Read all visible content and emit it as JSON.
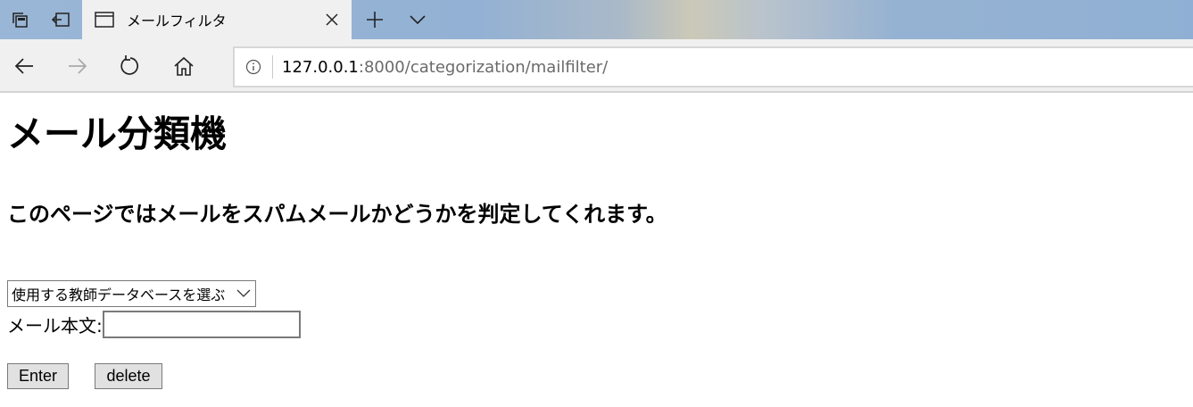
{
  "browser": {
    "tab": {
      "title": "メールフィルタ"
    },
    "address": {
      "host": "127.0.0.1",
      "rest": ":8000/categorization/mailfilter/"
    },
    "icons": {
      "tab_actions": "tab-actions-icon",
      "set_aside": "set-aside-tabs-icon",
      "page": "page-icon",
      "close": "close-icon",
      "new_tab": "plus-icon",
      "tab_list": "chevron-down-icon",
      "back": "back-arrow-icon",
      "forward": "forward-arrow-icon",
      "refresh": "refresh-icon",
      "home": "home-icon",
      "info": "info-icon"
    }
  },
  "page": {
    "title": "メール分類機",
    "description": "このページではメールをスパムメールかどうかを判定してくれます。",
    "select": {
      "selected": "使用する教師データベースを選ぶ"
    },
    "mail_label": "メール本文:",
    "mail_value": "",
    "enter_label": "Enter",
    "delete_label": "delete"
  }
}
